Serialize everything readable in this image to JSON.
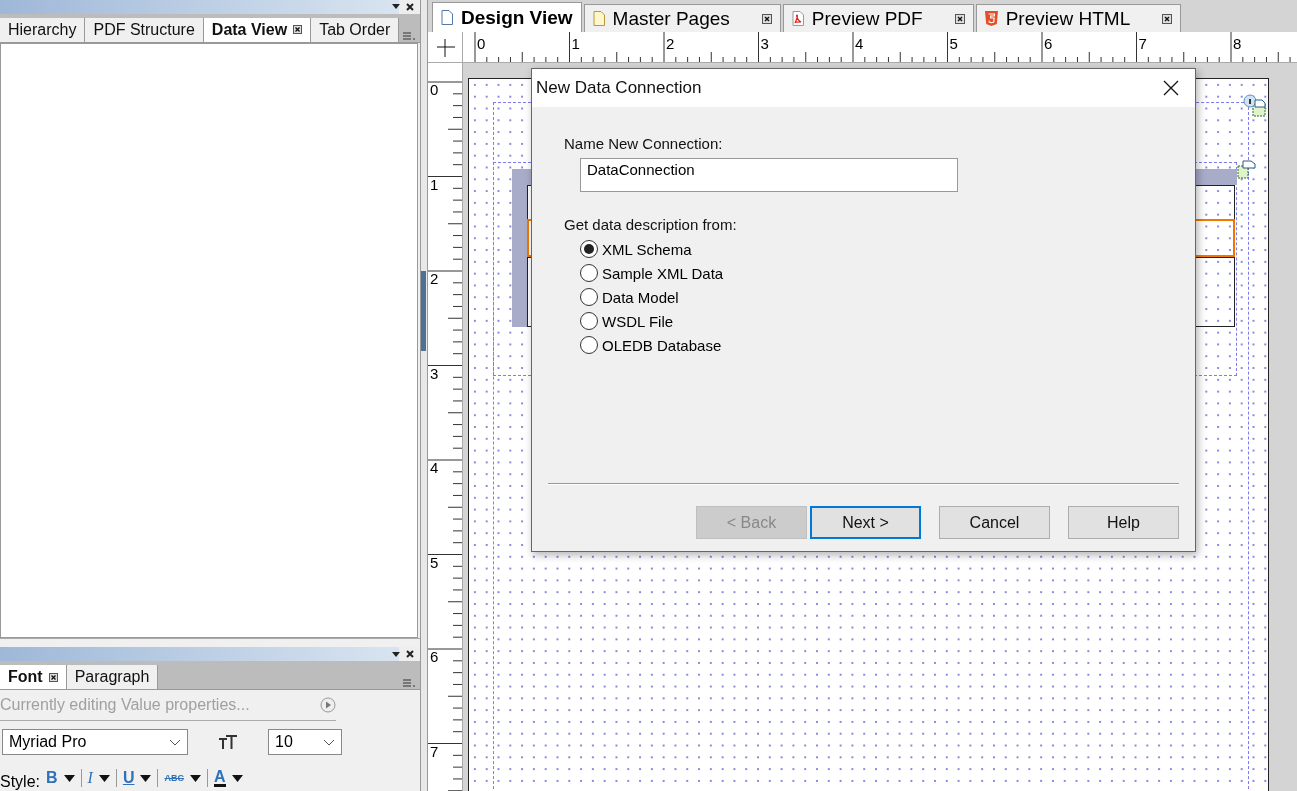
{
  "left_panel": {
    "tabs": [
      {
        "label": "Hierarchy",
        "selected": false,
        "closable": false
      },
      {
        "label": "PDF Structure",
        "selected": false,
        "closable": false
      },
      {
        "label": "Data View",
        "selected": true,
        "closable": true
      },
      {
        "label": "Tab Order",
        "selected": false,
        "closable": false
      }
    ]
  },
  "font_panel": {
    "tabs": [
      {
        "label": "Font",
        "selected": true,
        "closable": true
      },
      {
        "label": "Paragraph",
        "selected": false,
        "closable": false
      }
    ],
    "hint": "Currently editing Value properties...",
    "font_family": "Myriad Pro",
    "font_size": "10",
    "style_label": "Style:",
    "style_buttons": [
      {
        "kind": "bold",
        "label": "B"
      },
      {
        "kind": "italic",
        "label": "I"
      },
      {
        "kind": "underline",
        "label": "U"
      },
      {
        "kind": "strike",
        "label": "ABC"
      },
      {
        "kind": "color",
        "label": "A"
      }
    ]
  },
  "editor_tabs": [
    {
      "label": "Design View",
      "selected": true,
      "closable": false
    },
    {
      "label": "Master Pages",
      "selected": false,
      "closable": true
    },
    {
      "label": "Preview PDF",
      "selected": false,
      "closable": true
    },
    {
      "label": "Preview HTML",
      "selected": false,
      "closable": true
    }
  ],
  "ruler": {
    "horizontal": [
      "0",
      "1",
      "2",
      "3",
      "4",
      "5",
      "6",
      "7",
      "8"
    ],
    "vertical": [
      "0",
      "1",
      "2",
      "3",
      "4",
      "5",
      "6",
      "7"
    ]
  },
  "dialog": {
    "title": "New Data Connection",
    "name_label": "Name New Connection:",
    "name_value": "DataConnection",
    "source_label": "Get data description from:",
    "options": [
      {
        "label": "XML Schema",
        "selected": true
      },
      {
        "label": "Sample XML Data",
        "selected": false
      },
      {
        "label": "Data Model",
        "selected": false
      },
      {
        "label": "WSDL File",
        "selected": false
      },
      {
        "label": "OLEDB Database",
        "selected": false
      }
    ],
    "buttons": [
      {
        "label": "< Back",
        "disabled": true,
        "focused": false
      },
      {
        "label": "Next >",
        "disabled": false,
        "focused": true
      },
      {
        "label": "Cancel",
        "disabled": false,
        "focused": false
      },
      {
        "label": "Help",
        "disabled": false,
        "focused": false
      }
    ]
  }
}
